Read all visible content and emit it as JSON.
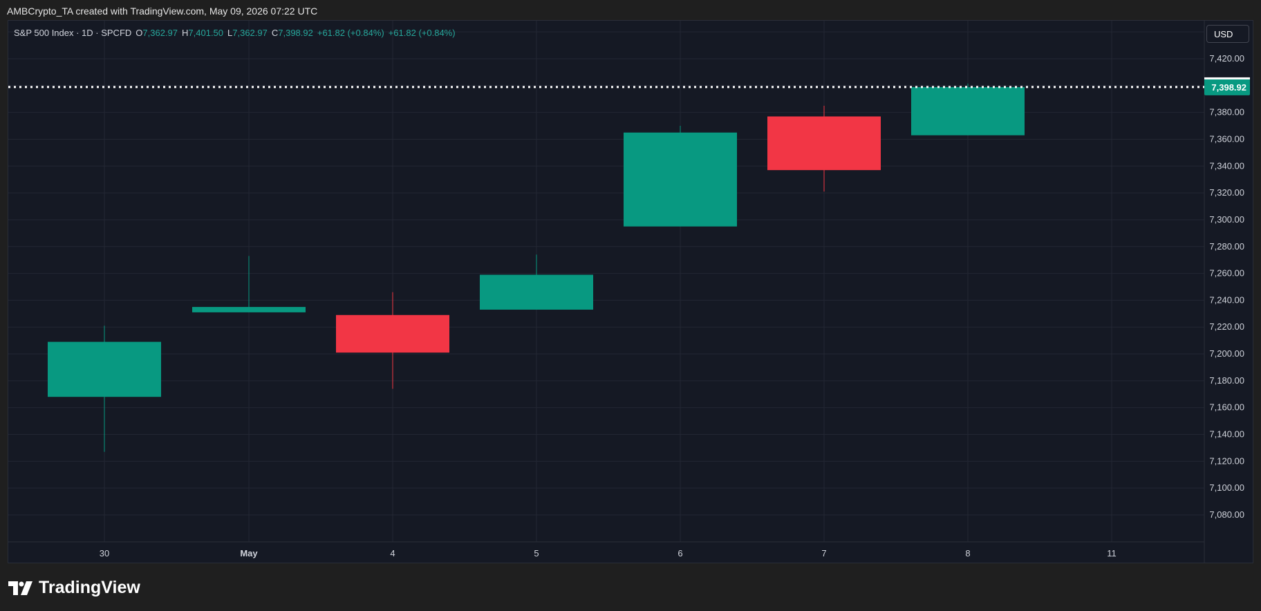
{
  "header": {
    "credit": "AMBCrypto_TA created with TradingView.com, May 09, 2026 07:22 UTC"
  },
  "legend": {
    "symbol": "S&P 500 Index · 1D · SPCFD",
    "open_label": "O",
    "open_value": "7,362.97",
    "high_label": "H",
    "high_value": "7,401.50",
    "low_label": "L",
    "low_value": "7,362.97",
    "close_label": "C",
    "close_value": "7,398.92",
    "change_1": "+61.82 (+0.84%)",
    "change_2": "+61.82 (+0.84%)"
  },
  "currency": "USD",
  "price_tag": "7,398.92",
  "brand": "TradingView",
  "colors": {
    "up": "#089981",
    "down": "#f23645",
    "background": "#151924",
    "grid": "#232733",
    "axis_text": "#d1d4dc"
  },
  "chart_data": {
    "type": "candlestick",
    "title": "S&P 500 Index · 1D · SPCFD",
    "ylim": [
      7060,
      7440
    ],
    "y_ticks": [
      7080,
      7100,
      7120,
      7140,
      7160,
      7180,
      7200,
      7220,
      7240,
      7260,
      7280,
      7300,
      7320,
      7340,
      7360,
      7380,
      7400,
      7420
    ],
    "y_tick_labels": [
      "7,080.00",
      "7,100.00",
      "7,120.00",
      "7,140.00",
      "7,160.00",
      "7,180.00",
      "7,200.00",
      "7,220.00",
      "7,240.00",
      "7,260.00",
      "7,280.00",
      "7,300.00",
      "7,320.00",
      "7,340.00",
      "7,360.00",
      "7,380.00",
      "7,400.00",
      "7,420.00"
    ],
    "x_ticks": [
      "30",
      "May",
      "4",
      "5",
      "6",
      "7",
      "8",
      "11"
    ],
    "grid": true,
    "last_price": 7398.92,
    "candles": [
      {
        "date": "Apr 30",
        "open": 7168,
        "high": 7221,
        "low": 7127,
        "close": 7209
      },
      {
        "date": "May 1",
        "open": 7231,
        "high": 7273,
        "low": 7231,
        "close": 7235
      },
      {
        "date": "May 4",
        "open": 7229,
        "high": 7246,
        "low": 7174,
        "close": 7201
      },
      {
        "date": "May 5",
        "open": 7233,
        "high": 7274,
        "low": 7233,
        "close": 7259
      },
      {
        "date": "May 6",
        "open": 7295,
        "high": 7370,
        "low": 7295,
        "close": 7365
      },
      {
        "date": "May 7",
        "open": 7377,
        "high": 7385,
        "low": 7321,
        "close": 7337
      },
      {
        "date": "May 8",
        "open": 7362.97,
        "high": 7401.5,
        "low": 7362.97,
        "close": 7398.92
      }
    ]
  }
}
